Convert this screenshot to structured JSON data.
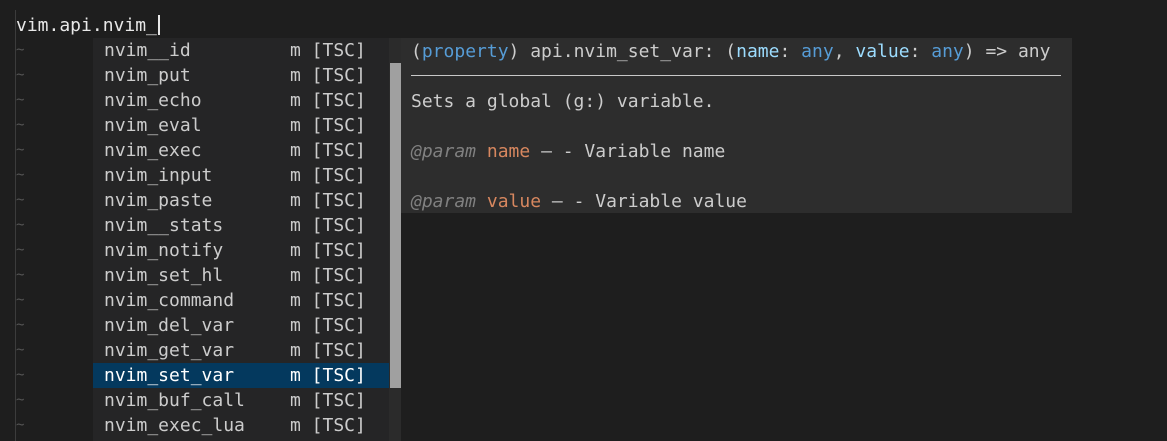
{
  "editor": {
    "command_text": "vim.api.nvim_",
    "tilde": "~"
  },
  "completion": {
    "items": [
      {
        "label": "nvim__id",
        "kind": "m [TSC]"
      },
      {
        "label": "nvim_put",
        "kind": "m [TSC]"
      },
      {
        "label": "nvim_echo",
        "kind": "m [TSC]"
      },
      {
        "label": "nvim_eval",
        "kind": "m [TSC]"
      },
      {
        "label": "nvim_exec",
        "kind": "m [TSC]"
      },
      {
        "label": "nvim_input",
        "kind": "m [TSC]"
      },
      {
        "label": "nvim_paste",
        "kind": "m [TSC]"
      },
      {
        "label": "nvim__stats",
        "kind": "m [TSC]"
      },
      {
        "label": "nvim_notify",
        "kind": "m [TSC]"
      },
      {
        "label": "nvim_set_hl",
        "kind": "m [TSC]"
      },
      {
        "label": "nvim_command",
        "kind": "m [TSC]"
      },
      {
        "label": "nvim_del_var",
        "kind": "m [TSC]"
      },
      {
        "label": "nvim_get_var",
        "kind": "m [TSC]"
      },
      {
        "label": "nvim_set_var",
        "kind": "m [TSC]",
        "selected": true
      },
      {
        "label": "nvim_buf_call",
        "kind": "m [TSC]"
      },
      {
        "label": "nvim_exec_lua",
        "kind": "m [TSC]"
      }
    ]
  },
  "doc": {
    "sig_open": "(",
    "sig_keyword": "property",
    "sig_middle": ") api.nvim_set_var: (",
    "sig_param1": "name",
    "sig_colon1": ": ",
    "sig_type1": "any",
    "sig_comma": ", ",
    "sig_param2": "value",
    "sig_colon2": ": ",
    "sig_type2": "any",
    "sig_end": ") => any",
    "description": "Sets a global (g:) variable.",
    "params": [
      {
        "tag": "@param",
        "name": "name",
        "text": " — - Variable name"
      },
      {
        "tag": "@param",
        "name": "value",
        "text": " — - Variable value"
      }
    ]
  }
}
